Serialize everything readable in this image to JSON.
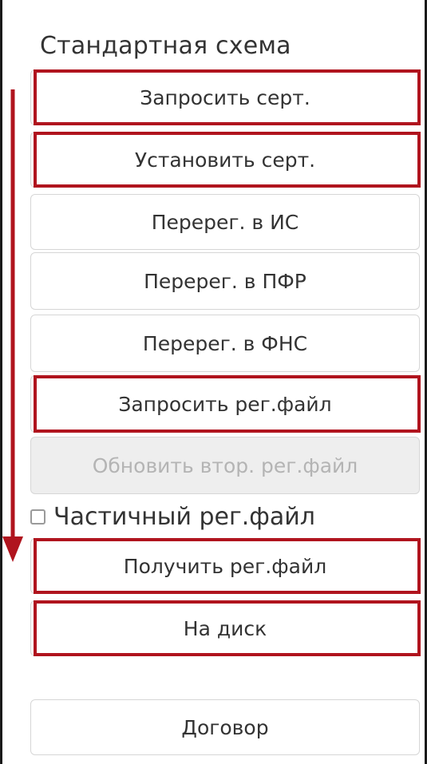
{
  "panel": {
    "heading": "Стандартная схема",
    "buttons": {
      "request_cert": "Запросить серт.",
      "install_cert": "Установить серт.",
      "rereg_is": "Перерег. в ИС",
      "rereg_pfr": "Перерег. в ПФР",
      "rereg_fns": "Перерег. в ФНС",
      "request_regfile": "Запросить рег.файл",
      "update_second_regfile": "Обновить втор. рег.файл",
      "get_regfile": "Получить рег.файл",
      "to_disk": "На диск",
      "contract": "Договор"
    },
    "partial_regfile": {
      "label": "Частичный рег.файл",
      "checked": false
    }
  },
  "colors": {
    "highlight": "#b0141e",
    "arrow": "#b0141e",
    "button_border": "#d6d6d6",
    "disabled_bg": "#eeeeee",
    "disabled_text": "#b4b4b4"
  }
}
